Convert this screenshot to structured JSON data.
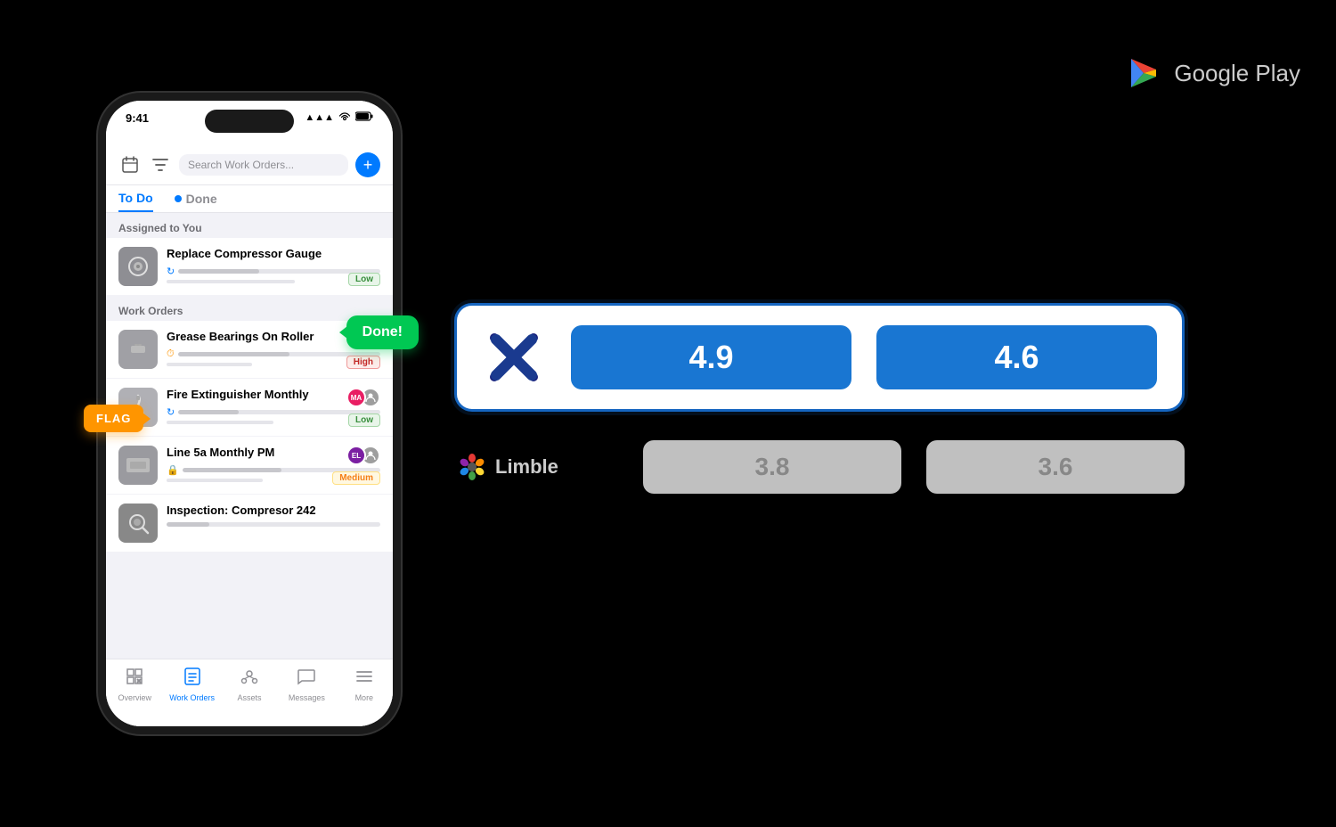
{
  "status_bar": {
    "time": "9:41",
    "signal": "▲▲▲",
    "wifi": "wifi",
    "battery": "battery"
  },
  "top_bar": {
    "search_placeholder": "Search Work Orders...",
    "add_label": "+"
  },
  "tabs": {
    "todo_label": "To Do",
    "done_label": "Done"
  },
  "section": {
    "assigned_label": "Assigned to You",
    "work_orders_label": "Work Orders"
  },
  "work_orders": [
    {
      "title": "Replace Compressor Gauge",
      "priority": "Low",
      "priority_class": "low",
      "icon": "⚙️",
      "progress": 40
    },
    {
      "title": "Grease Bearings On Roller",
      "priority": "High",
      "priority_class": "high",
      "icon": "🔧",
      "progress": 55
    },
    {
      "title": "Fire Extinguisher Monthly",
      "priority": "Low",
      "priority_class": "low",
      "icon": "🧯",
      "progress": 30,
      "has_avatars": true,
      "avatars": [
        {
          "initials": "MA",
          "color": "#e91e63"
        },
        {
          "initials": "",
          "color": "#9e9e9e"
        }
      ]
    },
    {
      "title": "Line 5a Monthly PM",
      "priority": "Medium",
      "priority_class": "medium",
      "icon": "🏭",
      "progress": 50,
      "has_avatars": true,
      "avatars": [
        {
          "initials": "EL",
          "color": "#7b1fa2"
        },
        {
          "initials": "",
          "color": "#9e9e9e"
        }
      ]
    },
    {
      "title": "Inspection: Compresor 242",
      "priority": "",
      "priority_class": "",
      "icon": "🔍",
      "progress": 20
    }
  ],
  "overlays": {
    "done_label": "Done!",
    "flag_label": "FLAG"
  },
  "bottom_nav": {
    "items": [
      {
        "label": "Overview",
        "icon": "✕",
        "active": false
      },
      {
        "label": "Work Orders",
        "icon": "📋",
        "active": true
      },
      {
        "label": "Assets",
        "icon": "⊞",
        "active": false
      },
      {
        "label": "Messages",
        "icon": "💬",
        "active": false
      },
      {
        "label": "More",
        "icon": "≡",
        "active": false
      }
    ]
  },
  "google_play": {
    "label": "Google Play"
  },
  "xenia_card": {
    "rating_ios": "4.9",
    "rating_android": "4.6"
  },
  "limble_row": {
    "name": "Limble",
    "rating_ios": "3.8",
    "rating_android": "3.6"
  }
}
